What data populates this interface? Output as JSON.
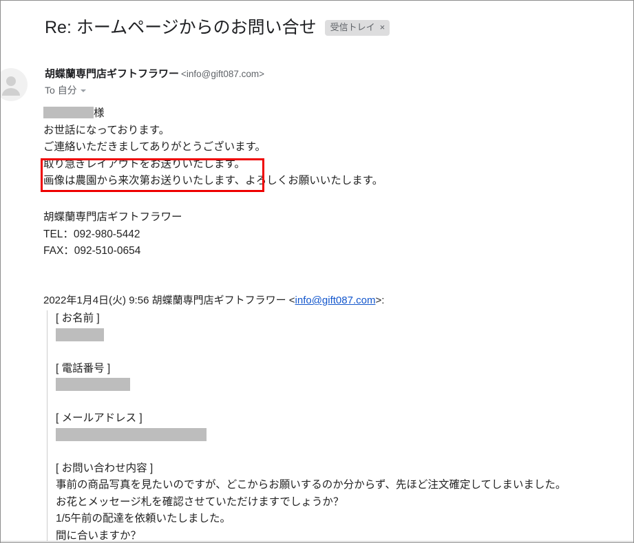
{
  "subject": {
    "text": "Re: ホームページからのお問い合せ",
    "label_chip": "受信トレイ",
    "label_close": "×"
  },
  "sender": {
    "name": "胡蝶蘭専門店ギフトフラワー",
    "email": "<info@gift087.com>",
    "to_prefix": "To",
    "to_value": "自分"
  },
  "body": {
    "greeting_suffix": "様",
    "line1": "お世話になっております。",
    "line2": "ご連絡いただきましてありがとうございます。",
    "line3": "取り急ぎレイアウトをお送りいたします。",
    "line4": "画像は農園から来次第お送りいたします、よろしくお願いいたします。"
  },
  "signature": {
    "company": "胡蝶蘭専門店ギフトフラワー",
    "tel": "TEL：092-980-5442",
    "fax": "FAX：092-510-0654"
  },
  "quote": {
    "header_prefix": "2022年1月4日(火) 9:56 胡蝶蘭専門店ギフトフラワー <",
    "header_link": "info@gift087.com",
    "header_suffix": ">:",
    "field_name_label": "[ お名前  ]",
    "field_phone_label": "[ 電話番号  ]",
    "field_email_label": "[ メールアドレス ]",
    "field_inquiry_label": "[ お問い合わせ内容 ]",
    "inquiry_line1": "事前の商品写真を見たいのですが、どこからお願いするのか分からず、先ほど注文確定してしまいました。",
    "inquiry_line2": "お花とメッセージ札を確認させていただけますでしょうか？",
    "inquiry_line3": "1/5午前の配達を依頼いたしました。",
    "inquiry_line4": "間に合いますか？"
  },
  "colors": {
    "link": "#1155cc",
    "annotation": "#ee0000",
    "redaction": "#bdbdbd",
    "muted_text": "#5f6368"
  }
}
